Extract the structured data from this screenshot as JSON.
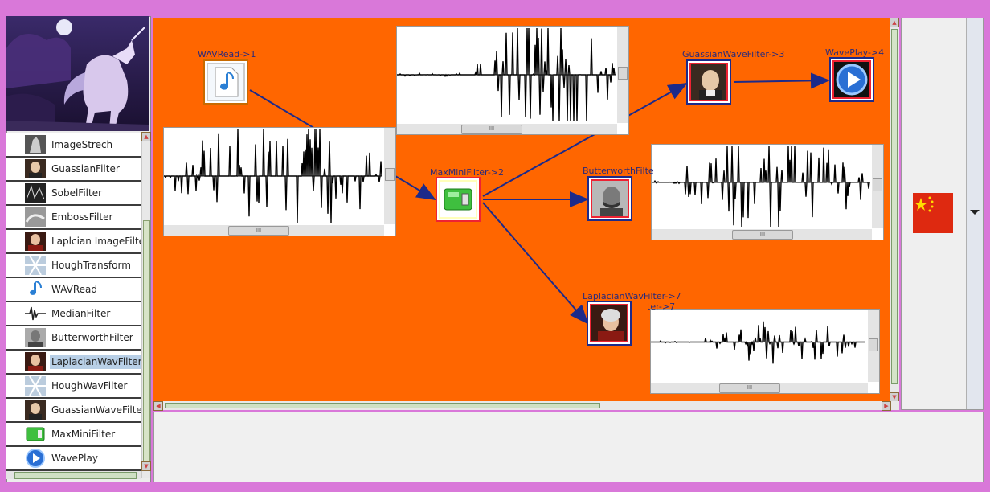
{
  "palette": {
    "items": [
      {
        "label": "ImageStrech",
        "icon": "grayscale-statue-icon"
      },
      {
        "label": "GuassianFilter",
        "icon": "gauss-portrait-icon"
      },
      {
        "label": "SobelFilter",
        "icon": "sobel-texture-icon"
      },
      {
        "label": "EmbossFilter",
        "icon": "emboss-texture-icon"
      },
      {
        "label": "Laplcian ImageFilter",
        "icon": "laplace-portrait-icon"
      },
      {
        "label": "HoughTransform",
        "icon": "hough-texture-icon"
      },
      {
        "label": "WAVRead",
        "icon": "music-note-icon"
      },
      {
        "label": "MedianFilter",
        "icon": "waveform-icon"
      },
      {
        "label": "ButterworthFilter",
        "icon": "butterworth-portrait-icon"
      },
      {
        "label": "LaplacianWavFilter",
        "icon": "laplace-portrait-icon"
      },
      {
        "label": "HoughWavFilter",
        "icon": "hough-texture-icon"
      },
      {
        "label": "GuassianWaveFilter",
        "icon": "gauss-portrait-icon"
      },
      {
        "label": "MaxMiniFilter",
        "icon": "battery-icon"
      },
      {
        "label": "WavePlay",
        "icon": "play-icon"
      }
    ],
    "selected": "LaplacianWavFilter"
  },
  "nodes": {
    "wavread": {
      "label": "WAVRead->1"
    },
    "maxmini": {
      "label": "MaxMiniFilter->2"
    },
    "gauss": {
      "label": "GuassianWaveFilter->3"
    },
    "waveplay": {
      "label": "WavePlay->4"
    },
    "butterworth": {
      "label": "ButterworthFilte"
    },
    "laplacian": {
      "label": "LaplacianWavFilter->7",
      "sublabel": "ter->7"
    }
  },
  "scroll_grip": "III",
  "flag": "china-flag-icon",
  "colors": {
    "canvas": "#ff6600",
    "frame": "#d978d9",
    "edge": "#1c2a8a"
  }
}
